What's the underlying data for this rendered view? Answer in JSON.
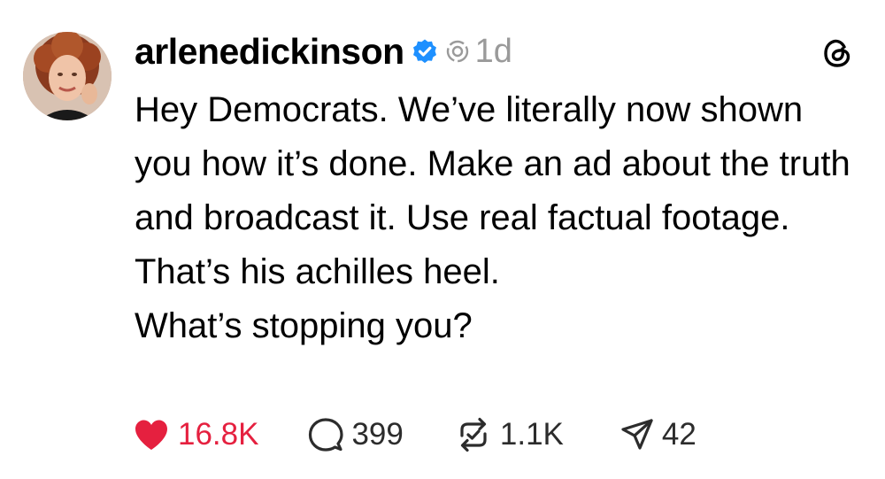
{
  "post": {
    "username": "arlenedickinson",
    "timestamp": "1d",
    "paragraphs": [
      "Hey Democrats.  We’ve  literally now shown  you how it’s done.  Make an ad about the truth and broadcast it. Use real factual footage. That’s his achilles heel.",
      "What’s stopping you?"
    ]
  },
  "actions": {
    "likes": "16.8K",
    "replies": "399",
    "reposts": "1.1K",
    "shares": "42"
  },
  "colors": {
    "like": "#e5203f",
    "verified": "#1e90ff",
    "muted": "#9a9a9a"
  },
  "icons": [
    "verified-badge-icon",
    "reposted-icon",
    "threads-logo-icon",
    "heart-icon",
    "comment-icon",
    "repost-icon",
    "share-icon"
  ]
}
